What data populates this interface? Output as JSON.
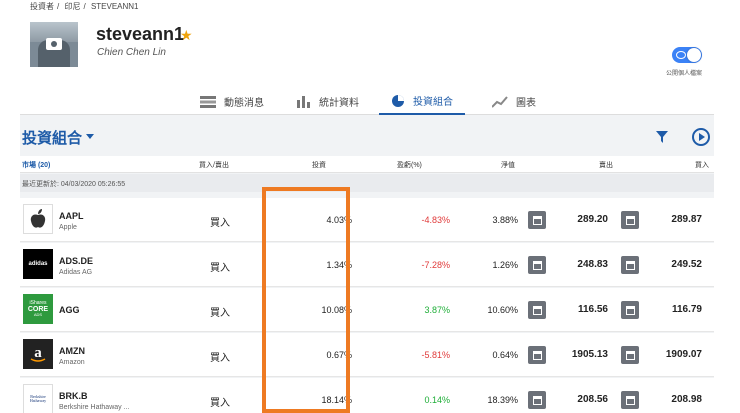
{
  "breadcrumb": [
    "投資者",
    "印尼",
    "STEVEANN1"
  ],
  "profile": {
    "username": "steveann1",
    "real_name": "Chien Chen Lin",
    "privacy_toggle_label": "公開個人檔案",
    "privacy_on": true
  },
  "tabs": [
    {
      "label": "動態消息",
      "icon": "feed-icon"
    },
    {
      "label": "統計資料",
      "icon": "stats-icon"
    },
    {
      "label": "投資組合",
      "icon": "pie-chart-icon",
      "active": true
    },
    {
      "label": "圖表",
      "icon": "chart-icon"
    }
  ],
  "portfolio": {
    "title": "投資組合",
    "columns": {
      "market": "市場 (20)",
      "buy_sell": "買入/賣出",
      "invested": "投資",
      "pl": "盈虧(%)",
      "net": "淨值",
      "sell": "賣出",
      "buy": "買入"
    },
    "last_updated": "最近更新於: 04/03/2020 05:26:55",
    "rows": [
      {
        "symbol": "AAPL",
        "name": "Apple",
        "action": "買入",
        "invested": "4.03%",
        "pl": "-4.83%",
        "pl_sign": "neg",
        "net": "3.88%",
        "sell": "289.20",
        "buy": "289.87"
      },
      {
        "symbol": "ADS.DE",
        "name": "Adidas AG",
        "action": "買入",
        "invested": "1.34%",
        "pl": "-7.28%",
        "pl_sign": "neg",
        "net": "1.26%",
        "sell": "248.83",
        "buy": "249.52"
      },
      {
        "symbol": "AGG",
        "name": "",
        "action": "買入",
        "invested": "10.08%",
        "pl": "3.87%",
        "pl_sign": "pos",
        "net": "10.60%",
        "sell": "116.56",
        "buy": "116.79"
      },
      {
        "symbol": "AMZN",
        "name": "Amazon",
        "action": "買入",
        "invested": "0.67%",
        "pl": "-5.81%",
        "pl_sign": "neg",
        "net": "0.64%",
        "sell": "1905.13",
        "buy": "1909.07"
      },
      {
        "symbol": "BRK.B",
        "name": "Berkshire Hathaway ...",
        "action": "買入",
        "invested": "18.14%",
        "pl": "0.14%",
        "pl_sign": "pos",
        "net": "18.39%",
        "sell": "208.56",
        "buy": "208.98"
      }
    ]
  },
  "logos": {
    "adidas": "adidas",
    "ishares_line1": "iShares",
    "ishares_line2": "CORE",
    "ishares_line3": "ADS",
    "berkshire_line1": "Berkshire",
    "berkshire_line2": "Hathaway"
  },
  "colors": {
    "accent": "#1e5ba8",
    "negative": "#e03a3a",
    "positive": "#1fae38",
    "highlight": "#ee7a22"
  }
}
